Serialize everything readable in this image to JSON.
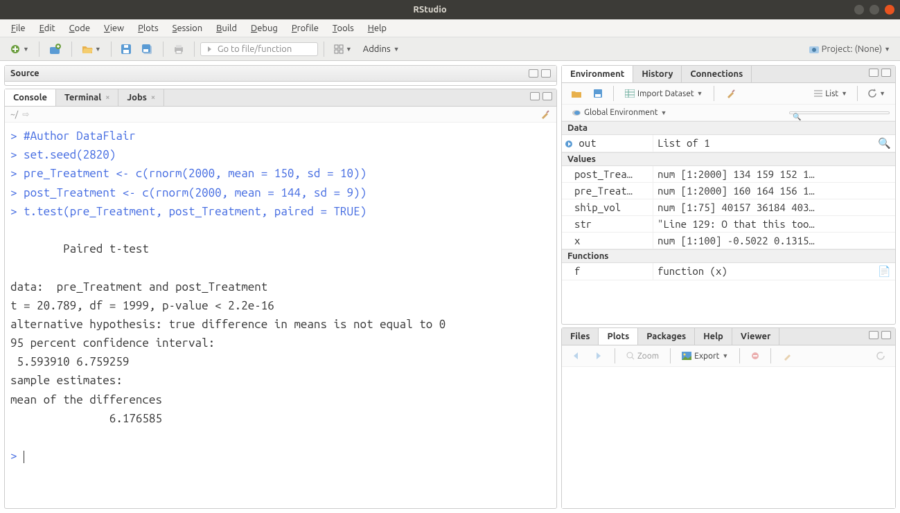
{
  "window": {
    "title": "RStudio"
  },
  "menubar": [
    "File",
    "Edit",
    "Code",
    "View",
    "Plots",
    "Session",
    "Build",
    "Debug",
    "Profile",
    "Tools",
    "Help"
  ],
  "toolbar": {
    "goto_placeholder": "Go to file/function",
    "addins": "Addins",
    "project": "Project: (None)"
  },
  "source_pane": {
    "title": "Source"
  },
  "console_pane": {
    "tabs": [
      {
        "label": "Console",
        "active": true,
        "closable": false
      },
      {
        "label": "Terminal",
        "active": false,
        "closable": true
      },
      {
        "label": "Jobs",
        "active": false,
        "closable": true
      }
    ],
    "path": "~/",
    "lines": [
      {
        "p": "> ",
        "cmd": "#Author DataFlair"
      },
      {
        "p": "> ",
        "cmd": "set.seed(2820)"
      },
      {
        "p": "> ",
        "cmd": "pre_Treatment <- c(rnorm(2000, mean = 150, sd = 10))"
      },
      {
        "p": "> ",
        "cmd": "post_Treatment <- c(rnorm(2000, mean = 144, sd = 9))"
      },
      {
        "p": "> ",
        "cmd": "t.test(pre_Treatment, post_Treatment, paired = TRUE)"
      },
      {
        "out": ""
      },
      {
        "out": "        Paired t-test"
      },
      {
        "out": ""
      },
      {
        "out": "data:  pre_Treatment and post_Treatment"
      },
      {
        "out": "t = 20.789, df = 1999, p-value < 2.2e-16"
      },
      {
        "out": "alternative hypothesis: true difference in means is not equal to 0"
      },
      {
        "out": "95 percent confidence interval:"
      },
      {
        "out": " 5.593910 6.759259"
      },
      {
        "out": "sample estimates:"
      },
      {
        "out": "mean of the differences "
      },
      {
        "out": "               6.176585 "
      },
      {
        "out": ""
      },
      {
        "p": "> ",
        "cmd": ""
      }
    ]
  },
  "env_pane": {
    "tabs": [
      {
        "label": "Environment",
        "active": true
      },
      {
        "label": "History",
        "active": false
      },
      {
        "label": "Connections",
        "active": false
      }
    ],
    "import": "Import Dataset",
    "list": "List",
    "scope": "Global Environment",
    "sections": [
      {
        "name": "Data",
        "rows": [
          {
            "icon": "play",
            "name": "out",
            "value": "List of 1",
            "search": true
          }
        ]
      },
      {
        "name": "Values",
        "rows": [
          {
            "name": "post_Trea…",
            "value": "num [1:2000] 134 159 152 1…"
          },
          {
            "name": "pre_Treat…",
            "value": "num [1:2000] 160 164 156 1…"
          },
          {
            "name": "ship_vol",
            "value": "num [1:75] 40157 36184 403…"
          },
          {
            "name": "str",
            "value": "\"Line 129: O that this too…"
          },
          {
            "name": "x",
            "value": "num [1:100] -0.5022 0.1315…"
          }
        ]
      },
      {
        "name": "Functions",
        "rows": [
          {
            "name": "f",
            "value": "function (x)",
            "doc": true
          }
        ]
      }
    ]
  },
  "plots_pane": {
    "tabs": [
      {
        "label": "Files",
        "active": false
      },
      {
        "label": "Plots",
        "active": true
      },
      {
        "label": "Packages",
        "active": false
      },
      {
        "label": "Help",
        "active": false
      },
      {
        "label": "Viewer",
        "active": false
      }
    ],
    "zoom": "Zoom",
    "export": "Export"
  }
}
